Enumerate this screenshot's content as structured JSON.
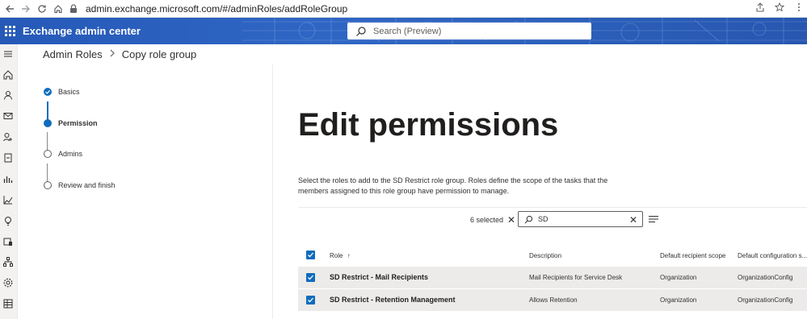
{
  "browser": {
    "url": "admin.exchange.microsoft.com/#/adminRoles/addRoleGroup"
  },
  "suite": {
    "app_title": "Exchange admin center",
    "search_placeholder": "Search (Preview)"
  },
  "breadcrumb": {
    "parent": "Admin Roles",
    "current": "Copy role group"
  },
  "wizard": {
    "steps": [
      {
        "label": "Basics",
        "state": "done"
      },
      {
        "label": "Permission",
        "state": "current"
      },
      {
        "label": "Admins",
        "state": "pending"
      },
      {
        "label": "Review and finish",
        "state": "pending"
      }
    ]
  },
  "main": {
    "heading": "Edit permissions",
    "description": "Select the roles to add to the SD Restrict role group. Roles define the scope of the tasks that the members assigned to this role group have permission to manage.",
    "selected_count": "6 selected",
    "filter_value": "SD"
  },
  "table": {
    "columns": [
      "Role",
      "Description",
      "Default recipient scope",
      "Default configuration s..."
    ],
    "sort_indicator": "↑",
    "rows": [
      {
        "role": "SD Restrict - Mail Recipients",
        "description": "Mail Recipients for Service Desk",
        "recipient_scope": "Organization",
        "config_scope": "OrganizationConfig",
        "checked": true
      },
      {
        "role": "SD Restrict - Retention Management",
        "description": "Allows Retention",
        "recipient_scope": "Organization",
        "config_scope": "OrganizationConfig",
        "checked": true
      }
    ]
  },
  "colors": {
    "accent": "#0f6cbd",
    "suite_bar": "#2b5fba"
  }
}
